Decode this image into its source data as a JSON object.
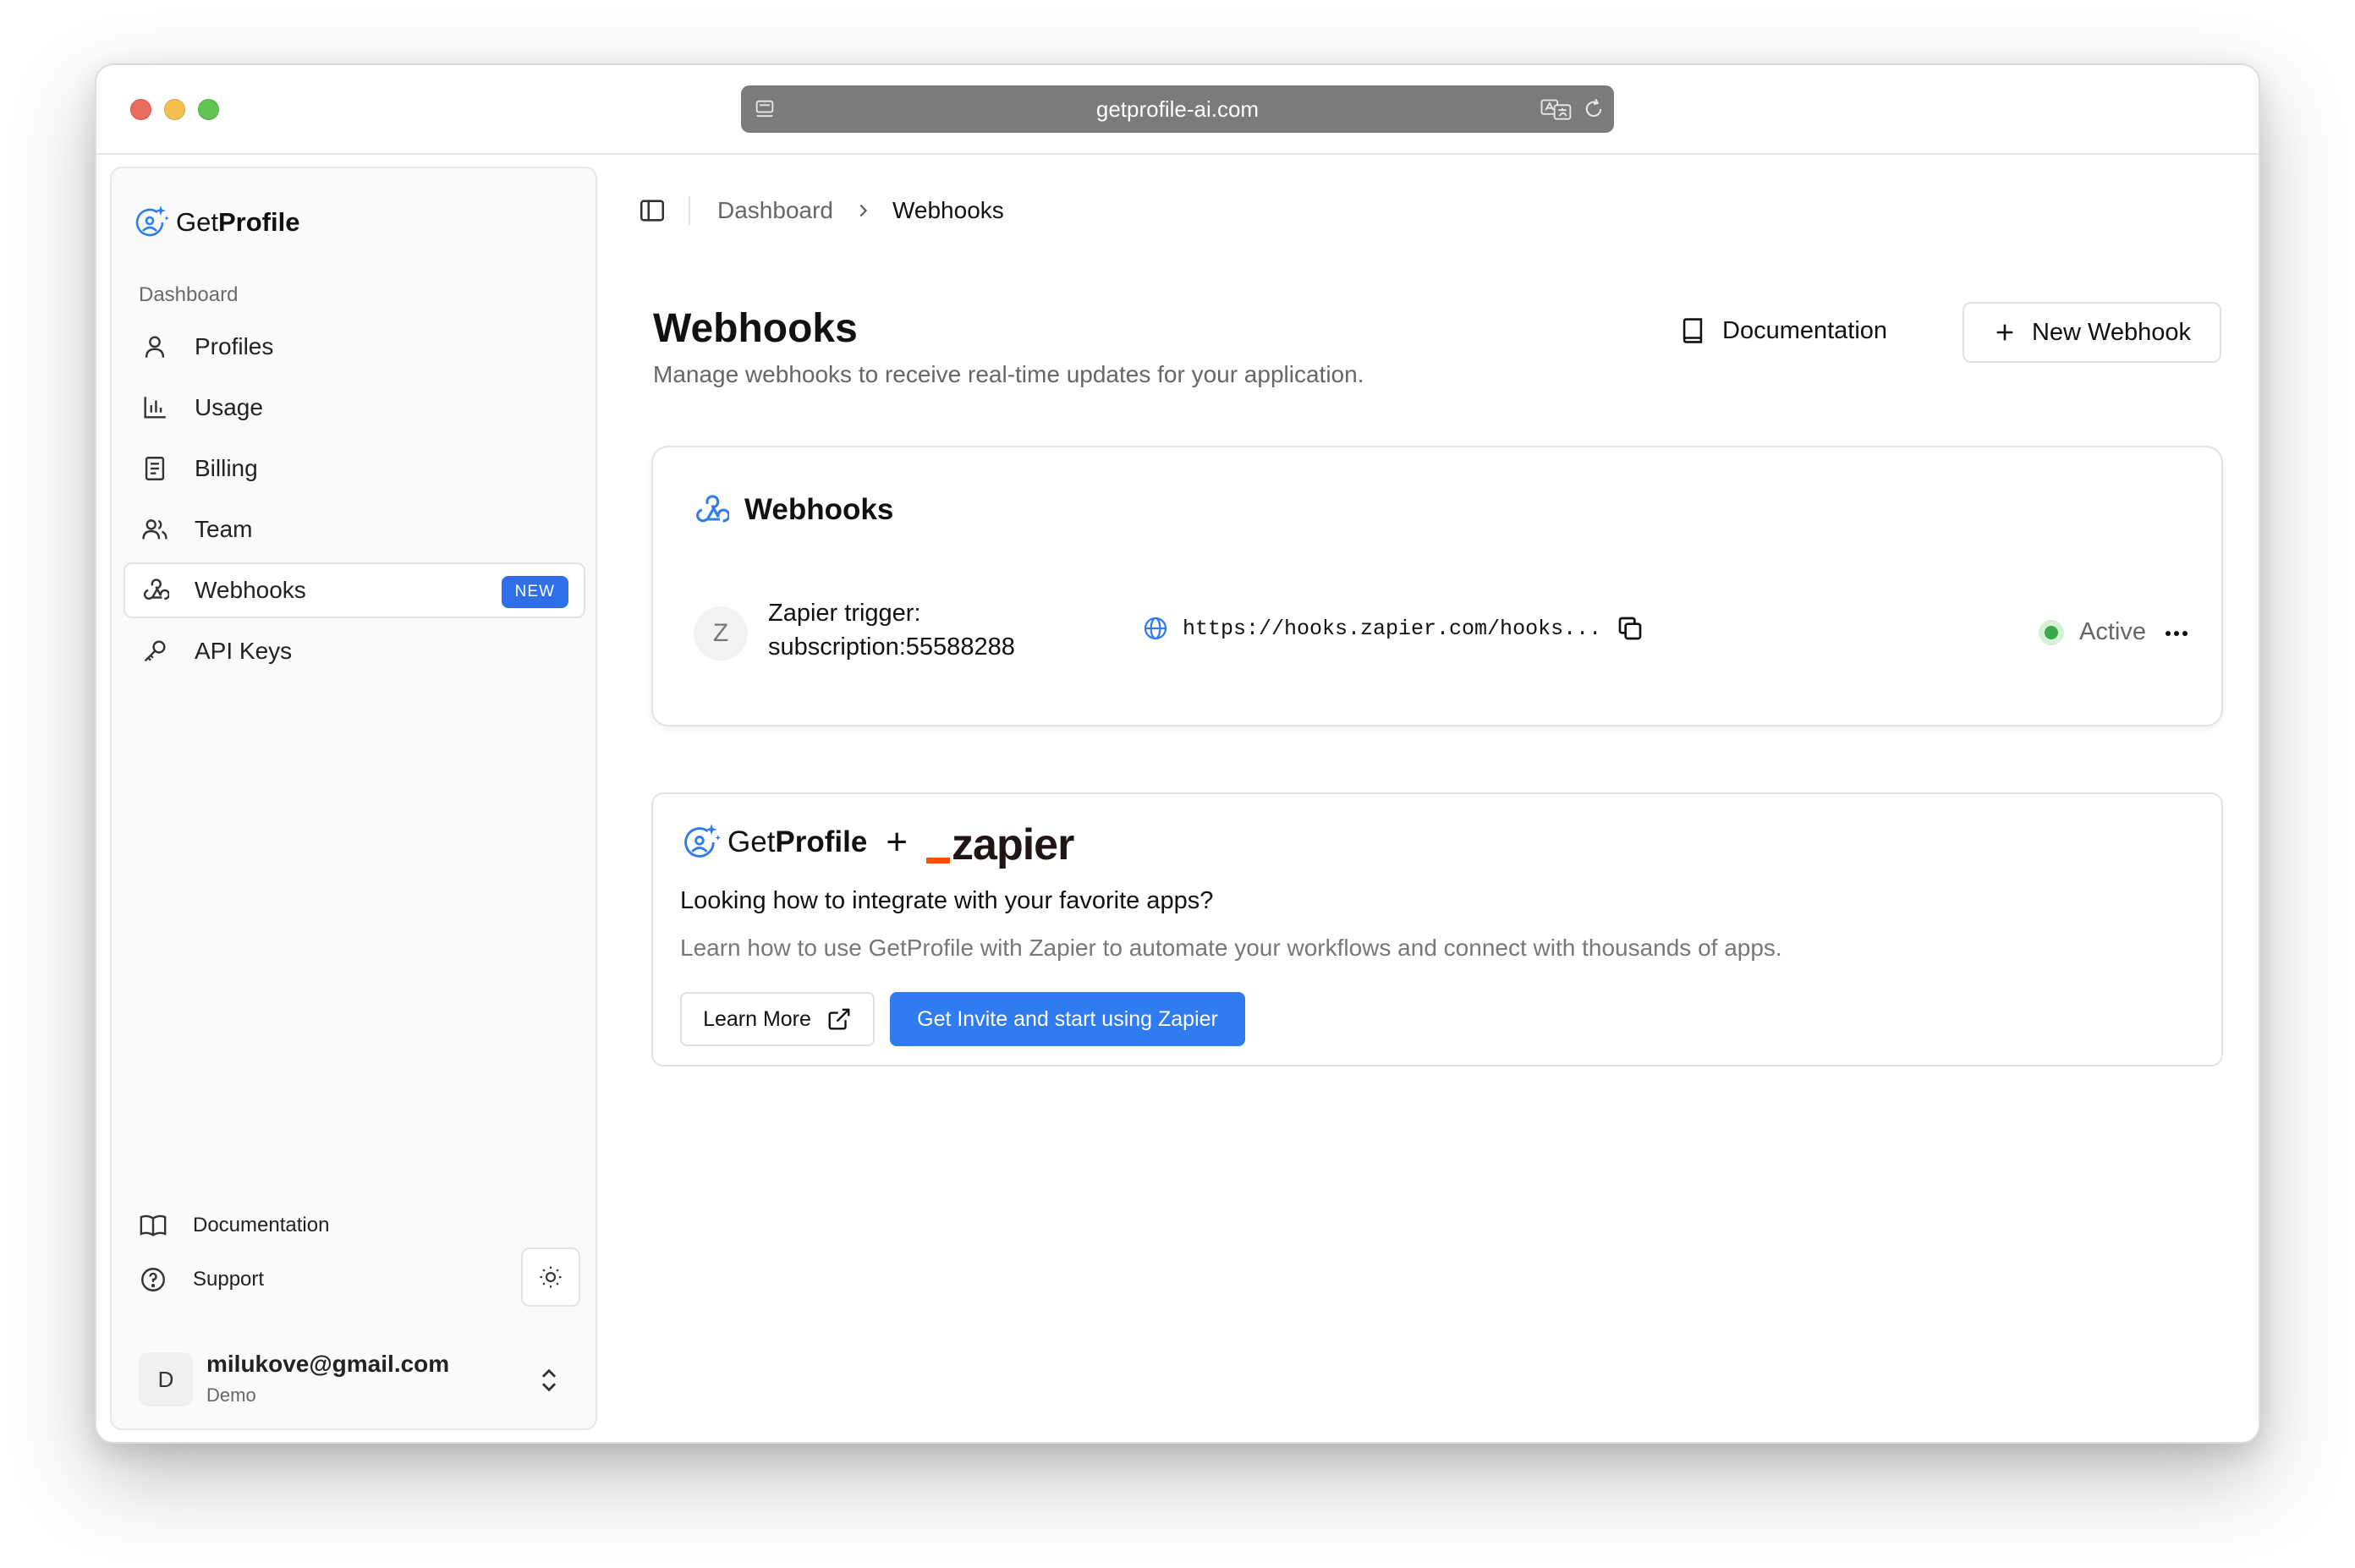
{
  "browser": {
    "url": "getprofile-ai.com"
  },
  "brand": {
    "name_light": "Get",
    "name_bold": "Profile"
  },
  "sidebar": {
    "section_label": "Dashboard",
    "items": [
      {
        "label": "Profiles",
        "icon": "user-icon"
      },
      {
        "label": "Usage",
        "icon": "bar-chart-icon"
      },
      {
        "label": "Billing",
        "icon": "receipt-icon"
      },
      {
        "label": "Team",
        "icon": "users-icon"
      },
      {
        "label": "Webhooks",
        "icon": "webhook-icon",
        "badge": "NEW",
        "active": true
      },
      {
        "label": "API Keys",
        "icon": "key-icon"
      }
    ],
    "footer": {
      "documentation": "Documentation",
      "support": "Support"
    },
    "user": {
      "initial": "D",
      "email": "milukove@gmail.com",
      "role": "Demo"
    }
  },
  "breadcrumb": {
    "parent": "Dashboard",
    "current": "Webhooks"
  },
  "header": {
    "title": "Webhooks",
    "subtitle": "Manage webhooks to receive real-time updates for your application.",
    "documentation_label": "Documentation",
    "new_webhook_label": "New Webhook"
  },
  "webhooks_card": {
    "title": "Webhooks",
    "rows": [
      {
        "initial": "Z",
        "name": "Zapier trigger: subscription:55588288",
        "url": "https://hooks.zapier.com/hooks...",
        "status": "Active",
        "status_color": "#3aa84a"
      }
    ]
  },
  "integration_card": {
    "brand_light": "Get",
    "brand_bold": "Profile",
    "plus": "+",
    "partner": "zapier",
    "question": "Looking how to integrate with your favorite apps?",
    "description": "Learn how to use GetProfile with Zapier to automate your workflows and connect with thousands of apps.",
    "learn_more_label": "Learn More",
    "invite_label": "Get Invite and start using Zapier"
  },
  "colors": {
    "accent": "#2f7bf0",
    "zapier_orange": "#ff4f00"
  }
}
